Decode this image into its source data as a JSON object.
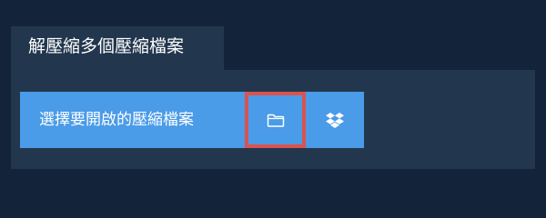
{
  "header": {
    "tab_label": "解壓縮多個壓縮檔案"
  },
  "actions": {
    "choose_file_label": "選擇要開啟的壓縮檔案",
    "folder_icon": "folder-icon",
    "dropbox_icon": "dropbox-icon"
  },
  "colors": {
    "page_background": "#13243a",
    "panel_background": "#22374e",
    "button_background": "#4a9be8",
    "highlight_border": "#d9534f",
    "text": "#ffffff"
  }
}
